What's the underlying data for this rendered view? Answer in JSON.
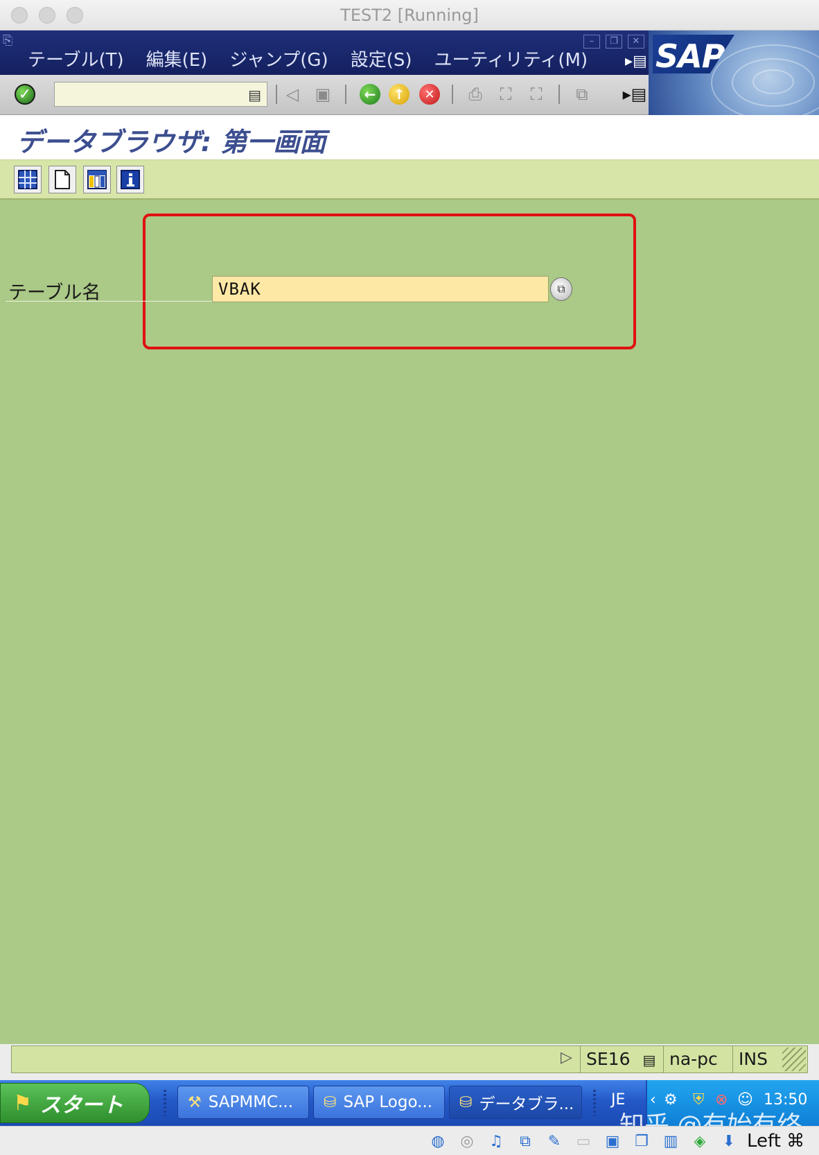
{
  "window": {
    "title": "TEST2 [Running]"
  },
  "menu": {
    "items": [
      {
        "label": "テーブル(T)"
      },
      {
        "label": "編集(E)"
      },
      {
        "label": "ジャンプ(G)"
      },
      {
        "label": "設定(S)"
      },
      {
        "label": "ユーティリティ(M)"
      }
    ]
  },
  "brand": {
    "logo": "SAP",
    "accent": "#1f2f7a"
  },
  "toolbar": {
    "command_value": ""
  },
  "screen": {
    "title": "データブラウザ: 第一画面"
  },
  "form": {
    "table_name_label": "テーブル名",
    "table_name_value": "VBAK"
  },
  "status": {
    "transaction": "SE16",
    "server": "na-pc",
    "mode": "INS"
  },
  "taskbar": {
    "start_label": "スタート",
    "items": [
      {
        "label": "SAPMMC..."
      },
      {
        "label": "SAP Logo..."
      },
      {
        "label": "データブラ..."
      }
    ],
    "ime": "JE",
    "clock": "13:50"
  },
  "vm": {
    "host_key": "Left ⌘"
  },
  "watermark": "知乎 @有始有终"
}
